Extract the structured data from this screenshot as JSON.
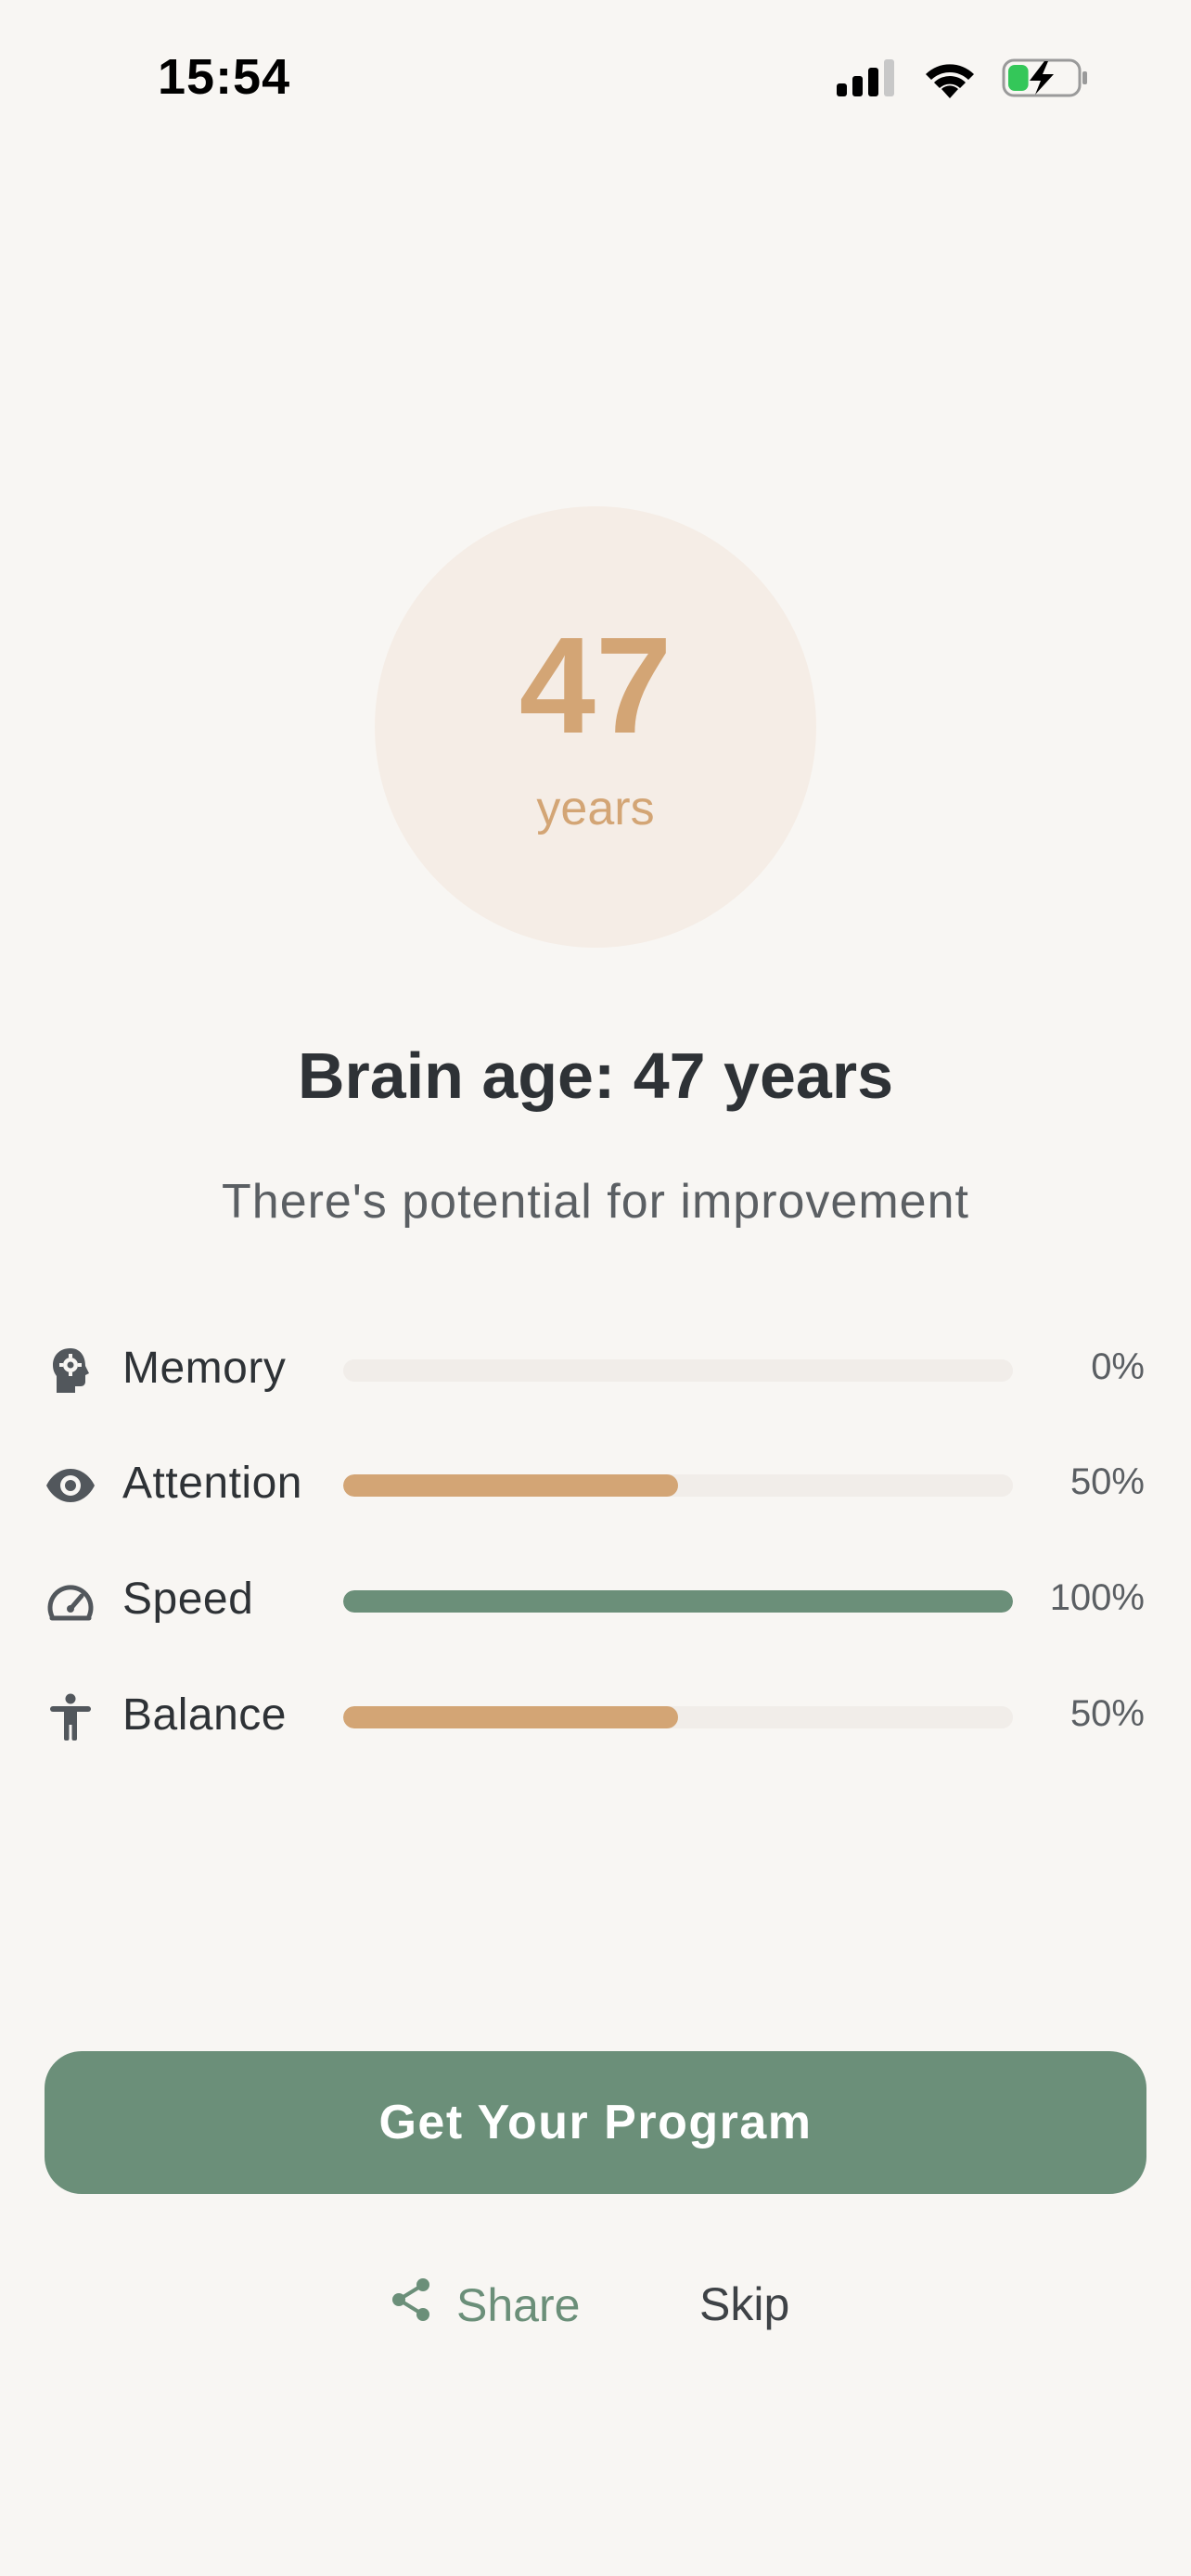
{
  "status_bar": {
    "time": "15:54",
    "icons": [
      "cellular-signal-icon",
      "wifi-icon",
      "battery-charging-icon"
    ],
    "battery_level": 0.3
  },
  "result": {
    "age_value": "47",
    "age_unit": "years",
    "headline": "Brain age: 47 years",
    "subline": "There's potential for improvement"
  },
  "metrics": [
    {
      "icon": "brain-head-icon",
      "label": "Memory",
      "value_text": "0%",
      "percent": 0,
      "color": "#D3A575"
    },
    {
      "icon": "eye-icon",
      "label": "Attention",
      "value_text": "50%",
      "percent": 50,
      "color": "#D3A575"
    },
    {
      "icon": "speedometer-icon",
      "label": "Speed",
      "value_text": "100%",
      "percent": 100,
      "color": "#6B8F79"
    },
    {
      "icon": "accessibility-person-icon",
      "label": "Balance",
      "value_text": "50%",
      "percent": 50,
      "color": "#D3A575"
    }
  ],
  "actions": {
    "cta_label": "Get Your Program",
    "share_label": "Share",
    "skip_label": "Skip"
  },
  "colors": {
    "background": "#F8F6F3",
    "accent_gold": "#D3A575",
    "accent_green": "#6B8F79",
    "circle_bg": "#F5EDE6",
    "track_bg": "#F1EDE9"
  }
}
